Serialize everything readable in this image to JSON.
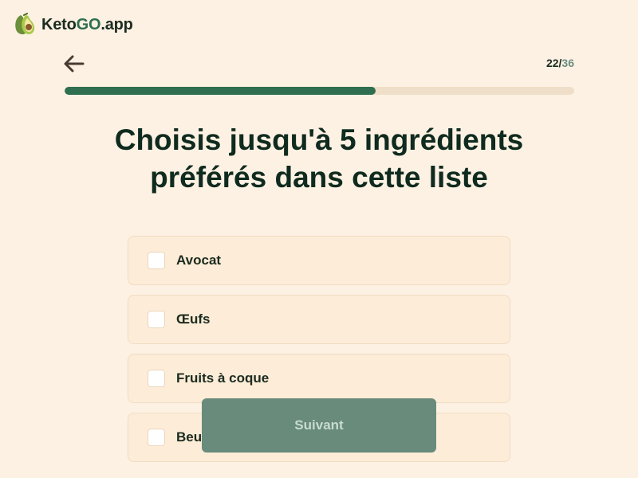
{
  "brand": {
    "name_start": "Keto",
    "name_mid": "G",
    "name_o": "O",
    "name_end": ".app",
    "accent": "#2f6e4f"
  },
  "header": {
    "back_icon": "arrow-left-icon",
    "step_current": "22",
    "step_separator": "/",
    "step_total": "36"
  },
  "progress": {
    "fraction": 0.6111
  },
  "question": {
    "title": "Choisis jusqu'à 5 ingrédients préférés dans cette liste"
  },
  "options": [
    {
      "label": "Avocat",
      "checked": false
    },
    {
      "label": "Œufs",
      "checked": false
    },
    {
      "label": "Fruits à coque",
      "checked": false
    },
    {
      "label": "Beurre",
      "checked": false
    }
  ],
  "footer": {
    "next_label": "Suivant"
  },
  "colors": {
    "background": "#fdf1e3",
    "primary": "#2f6e4f",
    "button": "#688b7b"
  }
}
